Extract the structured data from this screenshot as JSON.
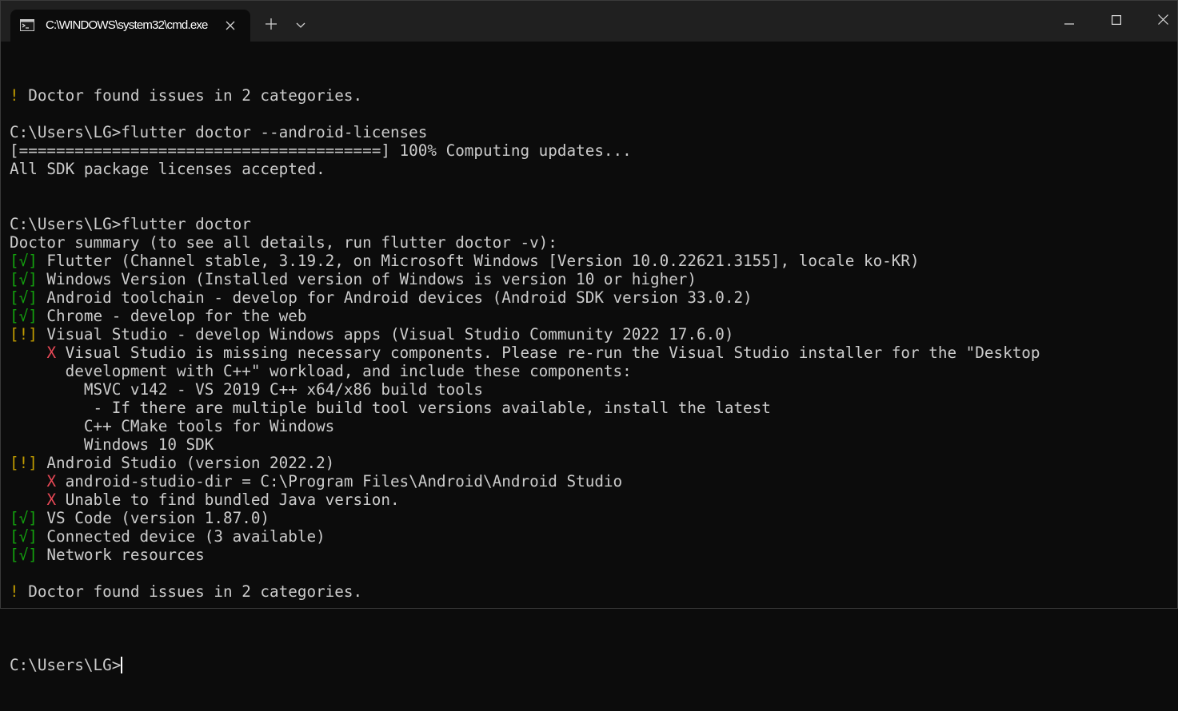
{
  "window": {
    "tab_title": "C:\\WINDOWS\\system32\\cmd.exe",
    "tab_icon": "cmd-prompt-icon",
    "new_tab_icon": "plus-icon",
    "dropdown_icon": "chevron-down-icon",
    "controls": [
      "minimize-icon",
      "maximize-icon",
      "close-icon"
    ]
  },
  "terminal": {
    "lines": [
      {
        "parts": [
          {
            "t": "! ",
            "c": "yellow"
          },
          {
            "t": "Doctor found issues in 2 categories.",
            "c": ""
          }
        ]
      },
      {
        "parts": []
      },
      {
        "parts": [
          {
            "t": "C:\\Users\\LG>flutter doctor --android-licenses",
            "c": ""
          }
        ]
      },
      {
        "parts": [
          {
            "t": "[=======================================] 100% Computing updates...",
            "c": ""
          }
        ]
      },
      {
        "parts": [
          {
            "t": "All SDK package licenses accepted.",
            "c": ""
          }
        ]
      },
      {
        "parts": []
      },
      {
        "parts": []
      },
      {
        "parts": [
          {
            "t": "C:\\Users\\LG>flutter doctor",
            "c": ""
          }
        ]
      },
      {
        "parts": [
          {
            "t": "Doctor summary (to see all details, run flutter doctor -v):",
            "c": ""
          }
        ]
      },
      {
        "parts": [
          {
            "t": "[√]",
            "c": "green"
          },
          {
            "t": " Flutter (Channel stable, 3.19.2, on Microsoft Windows [Version 10.0.22621.3155], locale ko-KR)",
            "c": ""
          }
        ]
      },
      {
        "parts": [
          {
            "t": "[√]",
            "c": "green"
          },
          {
            "t": " Windows Version (Installed version of Windows is version 10 or higher)",
            "c": ""
          }
        ]
      },
      {
        "parts": [
          {
            "t": "[√]",
            "c": "green"
          },
          {
            "t": " Android toolchain - develop for Android devices (Android SDK version 33.0.2)",
            "c": ""
          }
        ]
      },
      {
        "parts": [
          {
            "t": "[√]",
            "c": "green"
          },
          {
            "t": " Chrome - develop for the web",
            "c": ""
          }
        ]
      },
      {
        "parts": [
          {
            "t": "[!]",
            "c": "yellow"
          },
          {
            "t": " Visual Studio - develop Windows apps (Visual Studio Community 2022 17.6.0)",
            "c": ""
          }
        ]
      },
      {
        "parts": [
          {
            "t": "    ",
            "c": ""
          },
          {
            "t": "X",
            "c": "red"
          },
          {
            "t": " Visual Studio is missing necessary components. Please re-run the Visual Studio installer for the \"Desktop",
            "c": ""
          }
        ]
      },
      {
        "parts": [
          {
            "t": "      development with C++\" workload, and include these components:",
            "c": ""
          }
        ]
      },
      {
        "parts": [
          {
            "t": "        MSVC v142 - VS 2019 C++ x64/x86 build tools",
            "c": ""
          }
        ]
      },
      {
        "parts": [
          {
            "t": "         - If there are multiple build tool versions available, install the latest",
            "c": ""
          }
        ]
      },
      {
        "parts": [
          {
            "t": "        C++ CMake tools for Windows",
            "c": ""
          }
        ]
      },
      {
        "parts": [
          {
            "t": "        Windows 10 SDK",
            "c": ""
          }
        ]
      },
      {
        "parts": [
          {
            "t": "[!]",
            "c": "yellow"
          },
          {
            "t": " Android Studio (version 2022.2)",
            "c": ""
          }
        ]
      },
      {
        "parts": [
          {
            "t": "    ",
            "c": ""
          },
          {
            "t": "X",
            "c": "red"
          },
          {
            "t": " android-studio-dir = C:\\Program Files\\Android\\Android Studio",
            "c": ""
          }
        ]
      },
      {
        "parts": [
          {
            "t": "    ",
            "c": ""
          },
          {
            "t": "X",
            "c": "red"
          },
          {
            "t": " Unable to find bundled Java version.",
            "c": ""
          }
        ]
      },
      {
        "parts": [
          {
            "t": "[√]",
            "c": "green"
          },
          {
            "t": " VS Code (version 1.87.0)",
            "c": ""
          }
        ]
      },
      {
        "parts": [
          {
            "t": "[√]",
            "c": "green"
          },
          {
            "t": " Connected device (3 available)",
            "c": ""
          }
        ]
      },
      {
        "parts": [
          {
            "t": "[√]",
            "c": "green"
          },
          {
            "t": " Network resources",
            "c": ""
          }
        ]
      },
      {
        "parts": []
      },
      {
        "parts": [
          {
            "t": "! ",
            "c": "yellow"
          },
          {
            "t": "Doctor found issues in 2 categories.",
            "c": ""
          }
        ]
      },
      {
        "parts": []
      }
    ],
    "prompt": "C:\\Users\\LG>"
  }
}
